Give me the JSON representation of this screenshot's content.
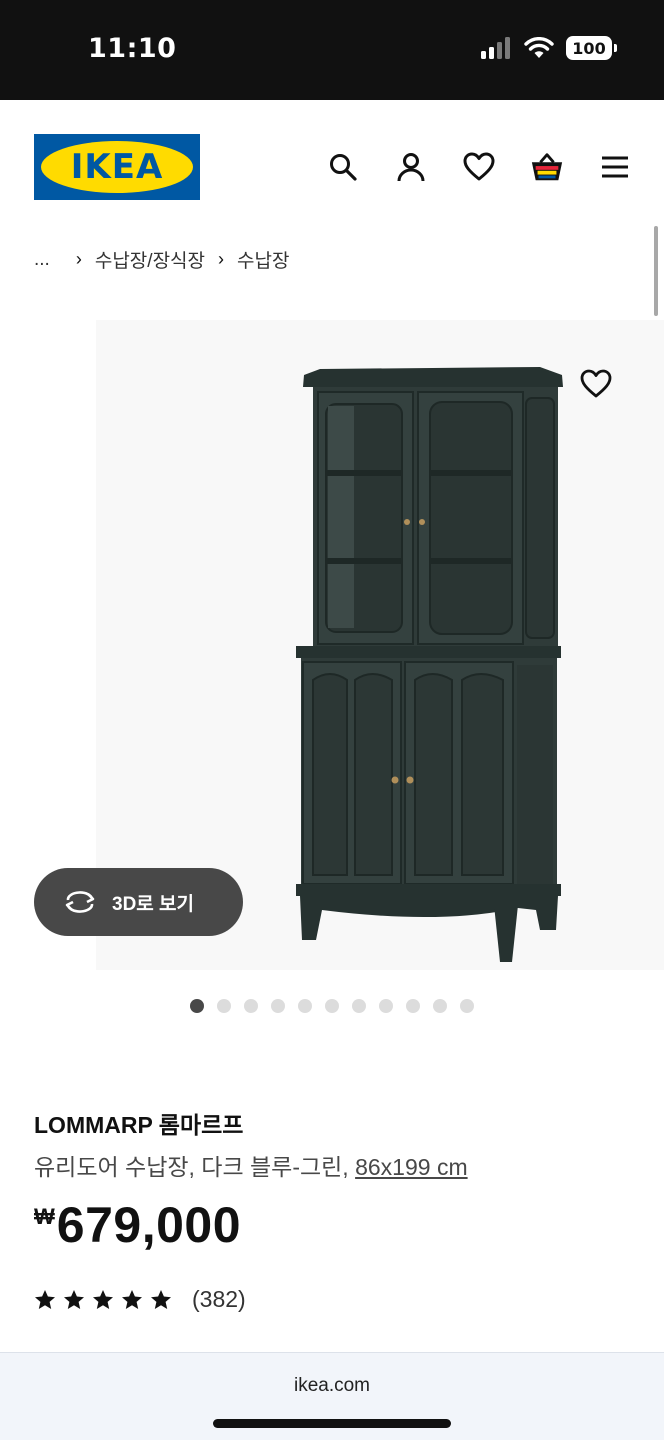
{
  "status": {
    "time": "11:10",
    "battery": "100"
  },
  "header": {
    "logo_text": "IKEA",
    "icons": [
      "search-icon",
      "user-icon",
      "heart-icon",
      "basket-icon",
      "menu-icon"
    ]
  },
  "breadcrumb": {
    "ellipsis": "...",
    "items": [
      "수납장/장식장",
      "수납장"
    ]
  },
  "gallery": {
    "view_3d_label": "3D로 보기",
    "dot_count": 11,
    "active_index": 0
  },
  "product": {
    "name": "LOMMARP 롬마르프",
    "description": "유리도어 수납장, 다크 블루-그린, ",
    "dimensions": "86x199 cm",
    "currency": "₩",
    "price": "679,000",
    "rating": 5,
    "review_count": "(382)"
  },
  "browser": {
    "url": "ikea.com"
  },
  "colors": {
    "ikea_blue": "#0058a3",
    "ikea_yellow": "#ffdb00",
    "cabinet": "#2f3b39",
    "basket_accent": "#e6253a"
  }
}
